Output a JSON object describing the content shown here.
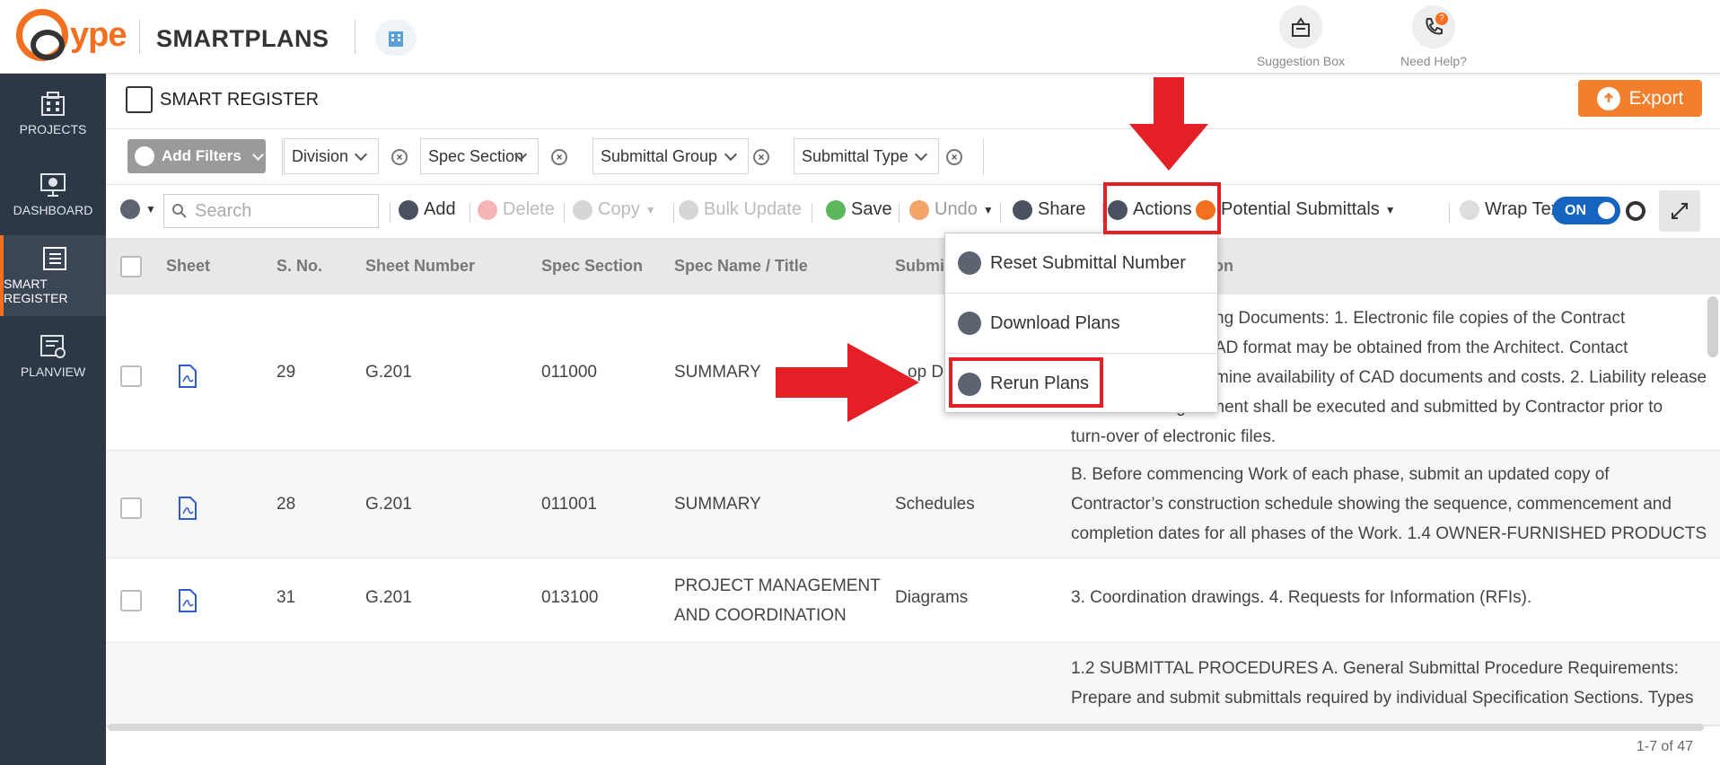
{
  "header": {
    "logo_text": "ype",
    "brand": "SMARTPLANS",
    "suggestion_label": "Suggestion Box",
    "help_label": "Need Help?",
    "help_badge": "?"
  },
  "sidebar": {
    "items": [
      {
        "label": "PROJECTS"
      },
      {
        "label": "DASHBOARD"
      },
      {
        "label": "SMART REGISTER"
      },
      {
        "label": "PLANVIEW"
      }
    ]
  },
  "title": {
    "text": "SMART REGISTER",
    "export_label": "Export"
  },
  "filters": {
    "add_label": "Add Filters",
    "items": [
      "Division",
      "Spec Section",
      "Submittal Group",
      "Submittal Type"
    ]
  },
  "toolbar": {
    "search_placeholder": "Search",
    "add": "Add",
    "delete": "Delete",
    "copy": "Copy",
    "bulk_update": "Bulk Update",
    "save": "Save",
    "undo": "Undo",
    "share": "Share",
    "actions": "Actions",
    "potential": "Potential Submittals",
    "wrap_text": "Wrap Text",
    "toggle": "ON"
  },
  "table": {
    "headers": [
      "Sheet",
      "S. No.",
      "Sheet Number",
      "Spec Section",
      "Spec Name / Title",
      "Submi",
      "on"
    ],
    "rows": [
      {
        "sno": "29",
        "sheet_number": "G.201",
        "spec_section": "011000",
        "spec_name": "SUMMARY",
        "submittal": "op D",
        "desc": [
          "ng Documents: 1. Electronic file copies of the Contract",
          "AD format may be obtained from the Architect. Contact",
          "mine availability of CAD documents and costs. 2. Liability release",
          "and transfer agreement shall be executed and submitted by Contractor prior to",
          "turn-over of electronic files."
        ]
      },
      {
        "sno": "28",
        "sheet_number": "G.201",
        "spec_section": "011001",
        "spec_name": "SUMMARY",
        "submittal": "Schedules",
        "desc": [
          "B. Before commencing Work of each phase, submit an updated copy of",
          "Contractor’s construction schedule showing the sequence, commencement and",
          "completion dates for all phases of the Work. 1.4 OWNER-FURNISHED PRODUCTS"
        ]
      },
      {
        "sno": "31",
        "sheet_number": "G.201",
        "spec_section": "013100",
        "spec_name_1": "PROJECT MANAGEMENT",
        "spec_name_2": "AND COORDINATION",
        "submittal": "Diagrams",
        "desc": [
          "3. Coordination drawings. 4. Requests for Information (RFIs)."
        ]
      },
      {
        "desc": [
          "1.2 SUBMITTAL PROCEDURES A. General Submittal Procedure Requirements:",
          "Prepare and submit submittals required by individual Specification Sections. Types"
        ]
      }
    ]
  },
  "menu": {
    "items": [
      "Reset Submittal Number",
      "Download Plans",
      "Rerun Plans"
    ]
  },
  "footer": {
    "pagination": "1-7 of 47"
  },
  "colors": {
    "brand_orange": "#f37021",
    "sidebar_bg": "#2d3847",
    "toggle_blue": "#1565c0",
    "annotation_red": "#e41f26"
  }
}
